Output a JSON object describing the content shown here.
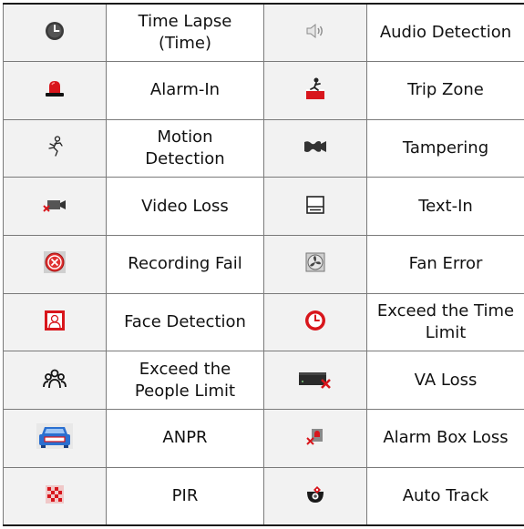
{
  "rows": [
    {
      "left": {
        "icon": "clock-dark-icon",
        "label": "Time Lapse\n(Time)"
      },
      "right": {
        "icon": "speaker-icon",
        "label": "Audio Detection"
      }
    },
    {
      "left": {
        "icon": "red-alarm-light-icon",
        "label": "Alarm-In"
      },
      "right": {
        "icon": "trip-zone-icon",
        "label": "Trip Zone"
      }
    },
    {
      "left": {
        "icon": "running-person-icon",
        "label": "Motion\nDetection"
      },
      "right": {
        "icon": "tampered-camera-icon",
        "label": "Tampering"
      }
    },
    {
      "left": {
        "icon": "camera-x-icon",
        "label": "Video Loss"
      },
      "right": {
        "icon": "text-document-icon",
        "label": "Text-In"
      }
    },
    {
      "left": {
        "icon": "red-x-circle-icon",
        "label": "Recording Fail"
      },
      "right": {
        "icon": "fan-icon",
        "label": "Fan Error"
      }
    },
    {
      "left": {
        "icon": "face-portrait-icon",
        "label": "Face Detection"
      },
      "right": {
        "icon": "clock-red-icon",
        "label": "Exceed the Time\nLimit"
      }
    },
    {
      "left": {
        "icon": "people-group-icon",
        "label": "Exceed the\nPeople Limit"
      },
      "right": {
        "icon": "va-device-x-icon",
        "label": "VA Loss"
      }
    },
    {
      "left": {
        "icon": "car-plate-icon",
        "label": "ANPR"
      },
      "right": {
        "icon": "alarm-box-x-icon",
        "label": "Alarm Box Loss"
      }
    },
    {
      "left": {
        "icon": "pir-sensor-icon",
        "label": "PIR"
      },
      "right": {
        "icon": "ptz-dome-icon",
        "label": "Auto Track"
      }
    }
  ],
  "colors": {
    "header_rule": "#1a1a1a",
    "grid": "#7a7a7a",
    "icon_bg": "#f2f2f2",
    "alarm_red": "#d8161c"
  }
}
